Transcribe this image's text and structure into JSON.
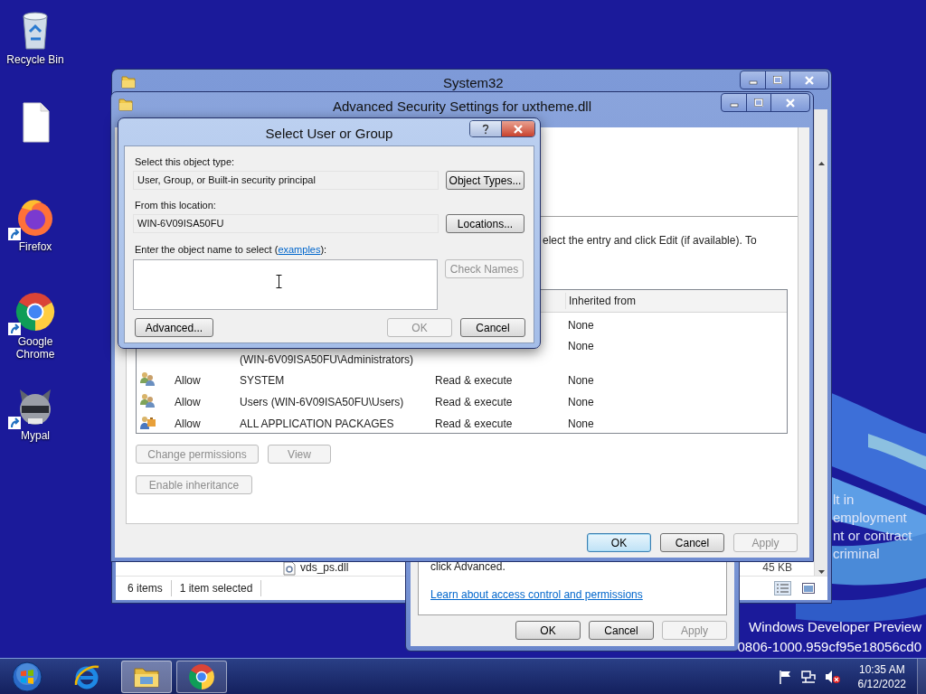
{
  "desktop_icons": [
    {
      "kind": "recycle_bin",
      "label": "Recycle Bin",
      "shortcut": false
    },
    {
      "kind": "file",
      "shortcut": false
    },
    {
      "kind": "firefox",
      "label": "Firefox",
      "shortcut": true
    },
    {
      "kind": "chrome",
      "label": "Google Chrome",
      "shortcut": true
    },
    {
      "kind": "mypal",
      "label": "Mypal",
      "shortcut": true
    }
  ],
  "background_text": [
    "lt in",
    "employment",
    "nt or contract",
    "criminal"
  ],
  "explorer": {
    "title": "System32",
    "file_row": {
      "name": "vds_ps.dll",
      "size": "45 KB"
    },
    "status_bar": [
      "6 items",
      "1 item selected"
    ]
  },
  "properties_window": {
    "text": "click Advanced.",
    "link": "Learn about access control and permissions",
    "buttons": [
      {
        "label": "OK",
        "disabled": false
      },
      {
        "label": "Cancel",
        "disabled": false
      },
      {
        "label": "Apply",
        "disabled": true
      }
    ]
  },
  "advanced_security": {
    "title": "Advanced Security Settings for uxtheme.dll",
    "instructions": "elect the entry and click Edit (if available). To",
    "table": {
      "columns": [
        "Inherited from"
      ],
      "rows": [
        {
          "kind": "partial",
          "inherited": "None"
        },
        {
          "kind": "wrapped",
          "principal": "(WIN-6V09ISA50FU\\Administrators)",
          "inherited": "None"
        },
        {
          "kind": "group",
          "type": "Allow",
          "principal": "SYSTEM",
          "access": "Read & execute",
          "inherited": "None"
        },
        {
          "kind": "group",
          "type": "Allow",
          "principal": "Users (WIN-6V09ISA50FU\\Users)",
          "access": "Read & execute",
          "inherited": "None"
        },
        {
          "kind": "package",
          "type": "Allow",
          "principal": "ALL APPLICATION PACKAGES",
          "access": "Read & execute",
          "inherited": "None"
        }
      ]
    },
    "permission_buttons": [
      {
        "label": "Change permissions",
        "disabled": true
      },
      {
        "label": "View",
        "disabled": true
      }
    ],
    "inheritance_button": {
      "label": "Enable inheritance",
      "disabled": true
    },
    "buttons": [
      {
        "label": "OK",
        "disabled": false,
        "default": true
      },
      {
        "label": "Cancel",
        "disabled": false,
        "default": false
      },
      {
        "label": "Apply",
        "disabled": true,
        "default": false
      }
    ]
  },
  "select_dialog": {
    "title": "Select User or Group",
    "object_type_label": "Select this object type:",
    "object_type": "User, Group, or Built-in security principal",
    "object_types_button": {
      "label": "Object Types...",
      "disabled": false
    },
    "location_label": "From this location:",
    "location": "WIN-6V09ISA50FU",
    "locations_button": {
      "label": "Locations...",
      "disabled": false
    },
    "name_label": [
      "Enter the object name to select (",
      "):"
    ],
    "name_link": "examples",
    "check_names_button": {
      "label": "Check Names",
      "disabled": true
    },
    "buttons": [
      {
        "label": "Advanced...",
        "disabled": false
      },
      {
        "label": "OK",
        "disabled": true
      },
      {
        "label": "Cancel",
        "disabled": false
      }
    ]
  },
  "watermark": [
    "Windows Developer Preview",
    "0806-1000.959cf95e18056cd0"
  ],
  "taskbar": {
    "apps": [
      {
        "kind": "start",
        "running": false,
        "selected": false
      },
      {
        "kind": "ie",
        "running": false,
        "selected": false
      },
      {
        "kind": "explorer",
        "running": true,
        "selected": true
      },
      {
        "kind": "chrome",
        "running": true,
        "selected": false
      }
    ],
    "volume_muted": true,
    "time": "10:35 AM",
    "date": "6/12/2022"
  }
}
